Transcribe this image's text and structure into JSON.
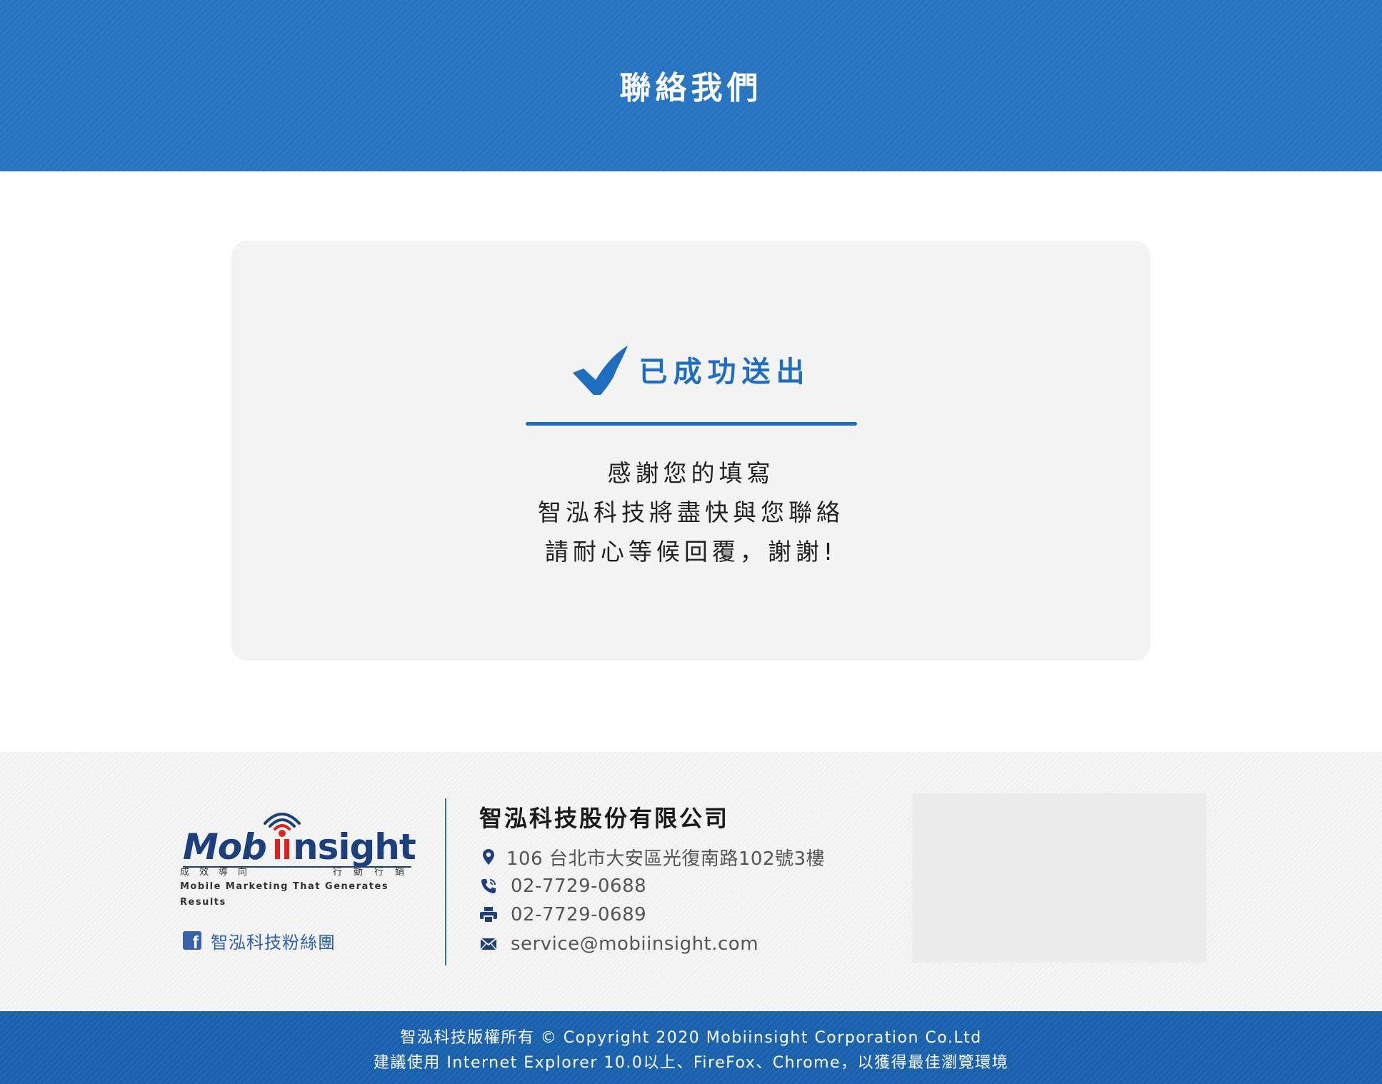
{
  "header": {
    "title": "聯絡我們"
  },
  "result": {
    "icon": "checkmark-icon",
    "title": "已成功送出",
    "accent_color": "#1e6dbf",
    "message_lines": [
      "感謝您的填寫",
      "智泓科技將盡快與您聯絡",
      "請耐心等候回覆，謝謝!"
    ]
  },
  "footer": {
    "logo": {
      "wordmark": "Mobiinsight",
      "tagline_zh_left": "成效導向",
      "tagline_zh_right": "行動行銷",
      "tagline_en": "Mobile Marketing That Generates Results"
    },
    "facebook": {
      "icon": "facebook-icon",
      "label": "智泓科技粉絲團"
    },
    "company": {
      "name": "智泓科技股份有限公司",
      "address_icon": "location-pin-icon",
      "address": "106 台北市大安區光復南路102號3樓",
      "phone_icon": "phone-icon",
      "phone": "02-7729-0688",
      "fax_icon": "printer-icon",
      "fax": "02-7729-0689",
      "email_icon": "envelope-icon",
      "email": "service@mobiinsight.com"
    }
  },
  "copyright": {
    "line1": "智泓科技版權所有 © Copyright 2020 Mobiinsight Corporation Co.Ltd",
    "line2": "建議使用 Internet Explorer 10.0以上、FireFox、Chrome，以獲得最佳瀏覽環境"
  },
  "colors": {
    "header_blue": "#2573c1",
    "copyright_blue": "#1a61ad",
    "logo_navy": "#1d3f7c",
    "logo_red": "#e0201a"
  }
}
